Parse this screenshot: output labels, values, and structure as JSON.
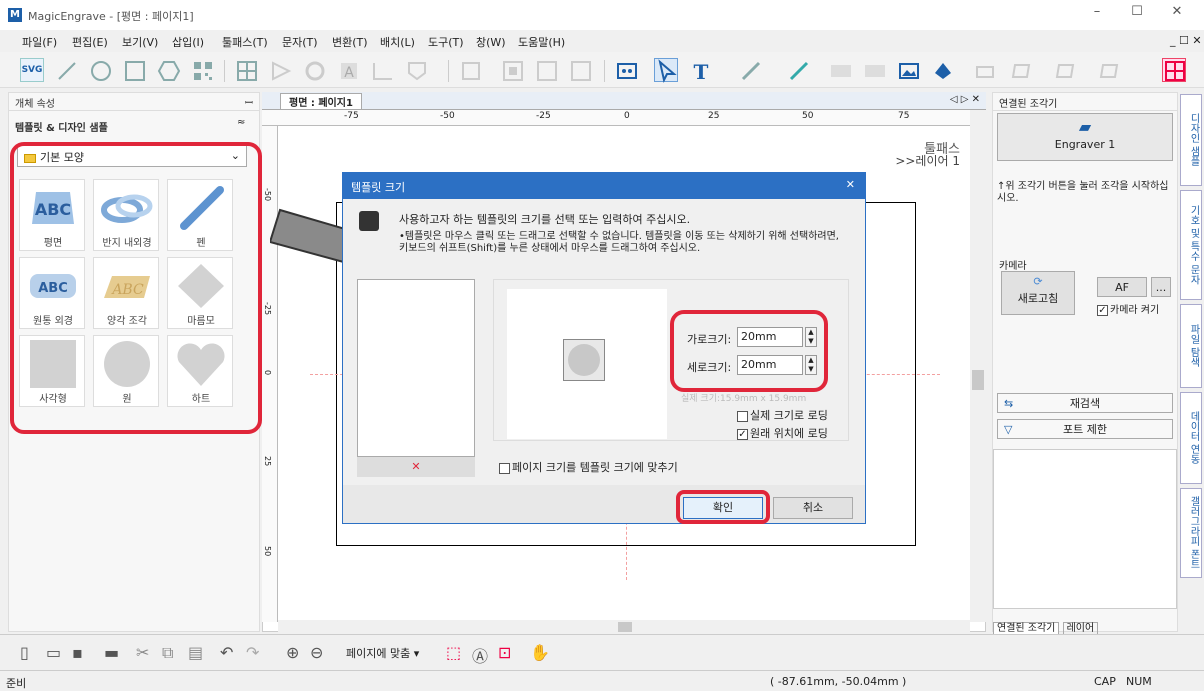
{
  "window": {
    "title": "MagicEngrave - [평면 : 페이지1]",
    "logo": "M",
    "minimize": "–",
    "maximize": "☐",
    "close": "✕",
    "mdi_controls": "_ ☐ ✕"
  },
  "menu": [
    "파일(F)",
    "편집(E)",
    "보기(V)",
    "삽입(I)",
    "툴패스(T)",
    "문자(T)",
    "변환(T)",
    "배치(L)",
    "도구(T)",
    "창(W)",
    "도움말(H)"
  ],
  "toolbar": {
    "svg_label": "SVG"
  },
  "left_panel": {
    "header": "개체 속성",
    "pin": "ꟷ",
    "section": "템플릿 & 디자인 샘플",
    "collapse": "≈",
    "dropdown_value": "기본 모양",
    "tiles": [
      {
        "label": "평면",
        "text": "ABC"
      },
      {
        "label": "반지 내외경",
        "text": ""
      },
      {
        "label": "펜",
        "text": ""
      },
      {
        "label": "원통 외경",
        "text": "ABC"
      },
      {
        "label": "양각 조각",
        "text": "ABC"
      },
      {
        "label": "마름모",
        "text": ""
      },
      {
        "label": "사각형",
        "text": ""
      },
      {
        "label": "원",
        "text": ""
      },
      {
        "label": "하트",
        "text": ""
      }
    ]
  },
  "canvas": {
    "tab": "평면 : 페이지1",
    "nav": "◁ ▷ ✕",
    "ruler_ticks": [
      "-75",
      "-50",
      "-25",
      "0",
      "25",
      "50",
      "75"
    ],
    "vruler_ticks": [
      "-50",
      "-25",
      "0",
      "25",
      "50"
    ],
    "layer_title": "툴패스",
    "layer_name": ">>레이어 1"
  },
  "right_panel": {
    "header": "연결된 조각기",
    "engraver": "Engraver 1",
    "hint": "↑위 조각기 버튼을 눌러 조각을 시작하십시오.",
    "camera": "카메라",
    "refresh": "새로고침",
    "af": "AF",
    "more": "...",
    "camera_on": "카메라 켜기",
    "rescan": "재검색",
    "port_limit": "포트 제한",
    "bottom_tab1": "연결된 조각기",
    "bottom_tab2": "레이어"
  },
  "vertical_tabs": [
    "디자인 샘플",
    "기호 및 특수 문자",
    "파일 탐색",
    "데이터 연동",
    "갤러그라피 폰트"
  ],
  "dialog": {
    "title": "템플릿 크기",
    "instruction": "사용하고자 하는 템플릿의 크기를 선택 또는 입력하여 주십시오.",
    "note": "•템플릿은 마우스 클릭 또는 드래그로 선택할 수 없습니다. 템플릿을 이동 또는 삭제하기 위해 선택하려면, 키보드의 쉬프트(Shift)를 누른 상태에서 마우스를 드래그하여 주십시오.",
    "width_label": "가로크기:",
    "width_value": "20mm",
    "height_label": "세로크기:",
    "height_value": "20mm",
    "actual_size": "실제 크기:15.9mm x 15.9mm",
    "load_actual": "실제 크기로 로딩",
    "load_original": "원래 위치에 로딩",
    "fit_page": "페이지 크기를 템플릿 크기에 맞추기",
    "delete_mark": "✕",
    "ok": "확인",
    "cancel": "취소"
  },
  "bottom_toolbar": {
    "zoom_fit": "페이지에 맞춤"
  },
  "status": {
    "left": "준비",
    "coords": "( -87.61mm, -50.04mm )",
    "caps": "CAP",
    "num": "NUM"
  },
  "colors": {
    "accent": "#2c70c4",
    "highlight": "#e0263a",
    "arrow": "#8a8a8a"
  }
}
